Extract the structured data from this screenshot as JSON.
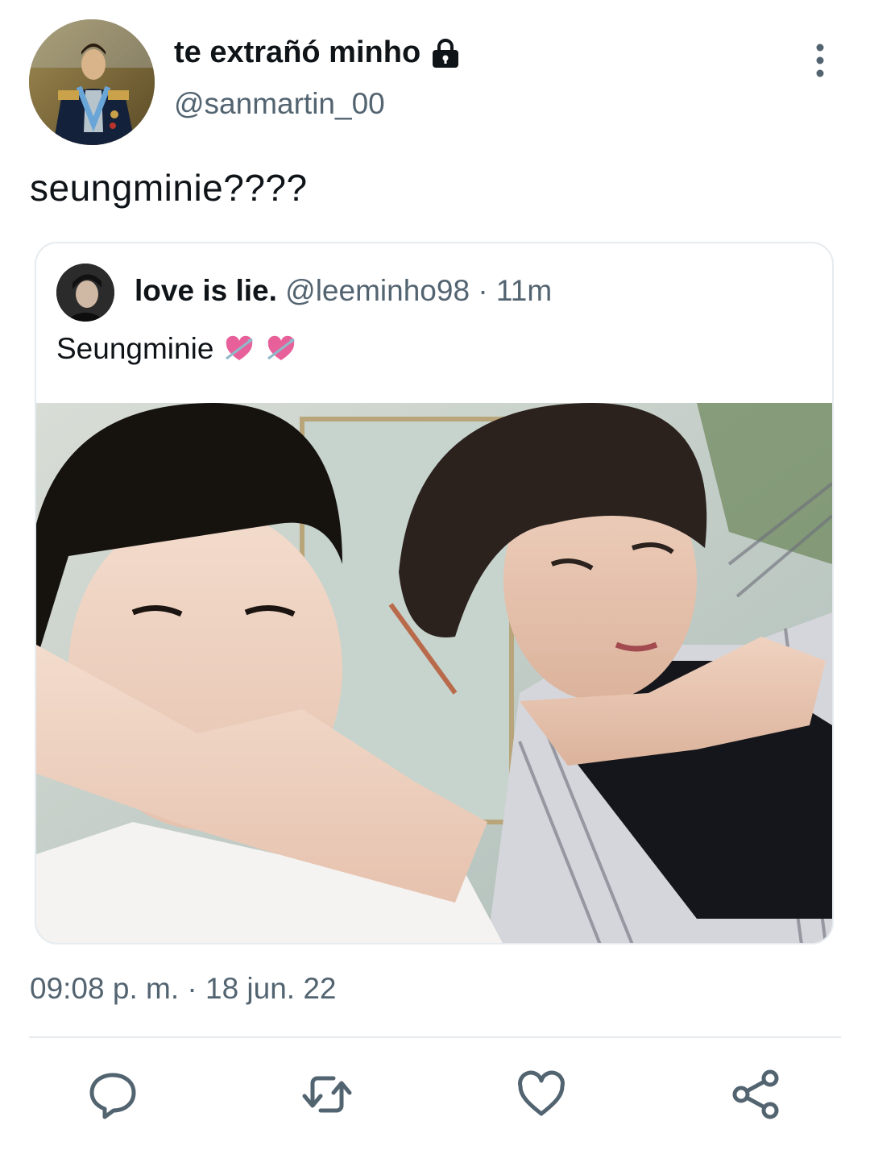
{
  "author": {
    "display_name": "te extrañó minho",
    "handle": "@sanmartin_00",
    "protected": true,
    "avatar_icon": "portrait-avatar"
  },
  "tweet": {
    "text": "seungminie????",
    "timestamp": "09:08 p. m. · 18 jun. 22"
  },
  "quoted_tweet": {
    "display_name": "love is lie.",
    "handle": "@leeminho98",
    "time": "· 11m",
    "text": "Seungminie",
    "emojis": [
      "heart-with-arrow-icon",
      "heart-with-arrow-icon"
    ],
    "media": "photo-two-people-selfie"
  },
  "actions": [
    "reply-icon",
    "retweet-icon",
    "like-icon",
    "share-icon"
  ],
  "colors": {
    "text_primary": "#0f1419",
    "text_secondary": "#536471",
    "border": "#e6ebef",
    "icon": "#536471"
  }
}
